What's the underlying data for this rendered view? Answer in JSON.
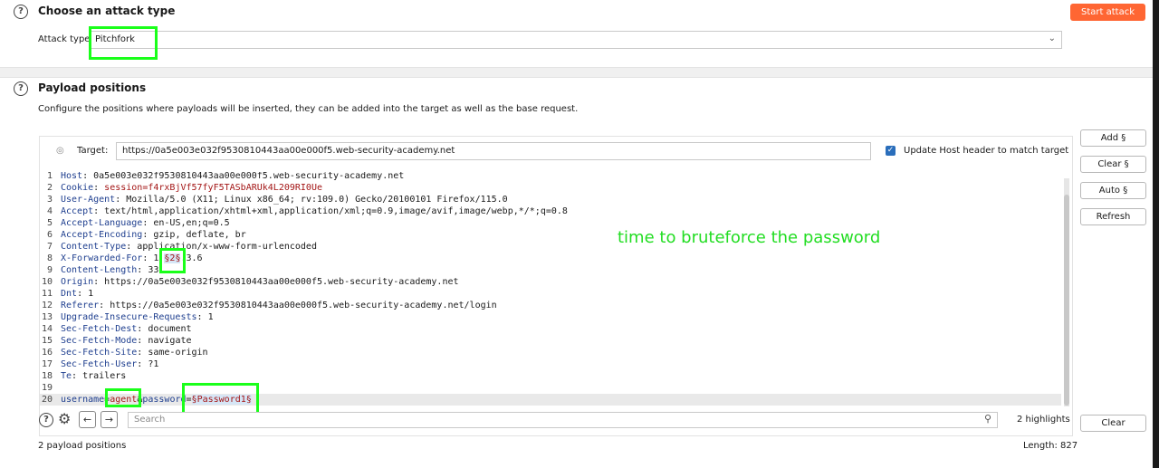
{
  "attack_section": {
    "title": "Choose an attack type",
    "attack_type_label": "Attack type:",
    "attack_type_value": "Pitchfork",
    "start_button": "Start attack"
  },
  "payload_section": {
    "title": "Payload positions",
    "description": "Configure the positions where payloads will be inserted, they can be added into the target as well as the base request.",
    "target_label": "Target:",
    "target_value": "https://0a5e003e032f9530810443aa00e000f5.web-security-academy.net",
    "update_host_label": "Update Host header to match target",
    "buttons": {
      "add": "Add §",
      "clear": "Clear §",
      "auto": "Auto §",
      "refresh": "Refresh"
    },
    "lines": [
      {
        "n": "1",
        "name": "Host",
        "val": "0a5e003e032f9530810443aa00e000f5.web-security-academy.net"
      },
      {
        "n": "2",
        "name": "Cookie",
        "val": "session=f4rxBjVf57fyF5TASbARUk4L209RI0Ue"
      },
      {
        "n": "3",
        "name": "User-Agent",
        "val": "Mozilla/5.0 (X11; Linux x86_64; rv:109.0) Gecko/20100101 Firefox/115.0"
      },
      {
        "n": "4",
        "name": "Accept",
        "val": "text/html,application/xhtml+xml,application/xml;q=0.9,image/avif,image/webp,*/*;q=0.8"
      },
      {
        "n": "5",
        "name": "Accept-Language",
        "val": "en-US,en;q=0.5"
      },
      {
        "n": "6",
        "name": "Accept-Encoding",
        "val": "gzip, deflate, br"
      },
      {
        "n": "7",
        "name": "Content-Type",
        "val": "application/x-www-form-urlencoded"
      },
      {
        "n": "8",
        "name": "X-Forwarded-For",
        "val_pre": "1.",
        "val_payload": "§2§",
        "val_post": ".3.6"
      },
      {
        "n": "9",
        "name": "Content-Length",
        "val": "33"
      },
      {
        "n": "10",
        "name": "Origin",
        "val": "https://0a5e003e032f9530810443aa00e000f5.web-security-academy.net"
      },
      {
        "n": "11",
        "name": "Dnt",
        "val": "1"
      },
      {
        "n": "12",
        "name": "Referer",
        "val": "https://0a5e003e032f9530810443aa00e000f5.web-security-academy.net/login"
      },
      {
        "n": "13",
        "name": "Upgrade-Insecure-Requests",
        "val": "1"
      },
      {
        "n": "14",
        "name": "Sec-Fetch-Dest",
        "val": "document"
      },
      {
        "n": "15",
        "name": "Sec-Fetch-Mode",
        "val": "navigate"
      },
      {
        "n": "16",
        "name": "Sec-Fetch-Site",
        "val": "same-origin"
      },
      {
        "n": "17",
        "name": "Sec-Fetch-User",
        "val": "?1"
      },
      {
        "n": "18",
        "name": "Te",
        "val": "trailers"
      },
      {
        "n": "19",
        "name": "",
        "val": ""
      },
      {
        "n": "20",
        "body_key1": "username",
        "body_val1": "agent",
        "body_key2": "password",
        "body_val2": "§Password1§"
      }
    ],
    "annotation": "time to bruteforce the password",
    "search_placeholder": "Search",
    "highlights": "2 highlights",
    "clear_button": "Clear",
    "payload_count": "2 payload positions",
    "length": "Length: 827"
  },
  "colors": {
    "accent": "#ff6633",
    "annotation_green": "#22dd22",
    "checkbox_blue": "#2a6ebb"
  }
}
